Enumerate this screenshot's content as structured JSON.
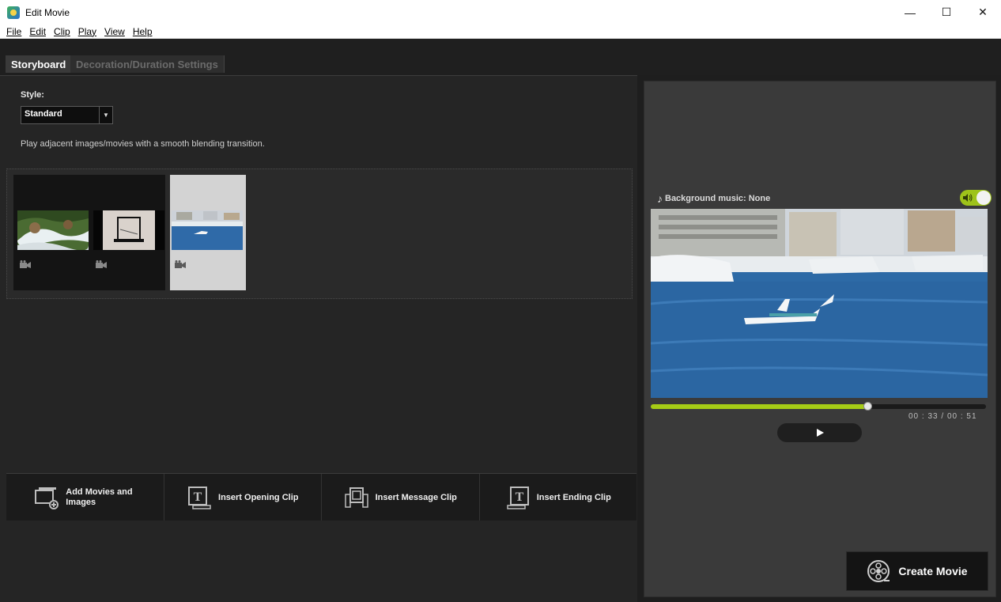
{
  "window": {
    "title": "Edit Movie",
    "minimize": "—",
    "maximize": "☐",
    "close": "✕"
  },
  "menu": [
    {
      "label": "File"
    },
    {
      "label": "Edit"
    },
    {
      "label": "Clip"
    },
    {
      "label": "Play"
    },
    {
      "label": "View"
    },
    {
      "label": "Help"
    }
  ],
  "tabs": {
    "storyboard": "Storyboard",
    "decoration": "Decoration/Duration Settings"
  },
  "style": {
    "label": "Style:",
    "selected": "Standard",
    "description": "Play adjacent images/movies with a smooth blending transition."
  },
  "clips": [
    {
      "type": "movie",
      "icon": "movie-camera-icon",
      "selected": false
    },
    {
      "type": "movie",
      "icon": "movie-camera-icon",
      "selected": false
    },
    {
      "type": "movie",
      "icon": "movie-camera-icon",
      "selected": true
    }
  ],
  "toolbar": {
    "add": "Add Movies and Images",
    "opening": "Insert Opening Clip",
    "message": "Insert Message Clip",
    "ending": "Insert Ending Clip"
  },
  "preview": {
    "music_label": "Background music: None",
    "current_time": "00 : 33",
    "separator": "/",
    "total_time": "00 : 51",
    "progress": 0.647
  },
  "create": {
    "label": "Create Movie"
  },
  "colors": {
    "accent": "#a6cc16",
    "panel": "#3a3a3a",
    "background": "#252525"
  }
}
